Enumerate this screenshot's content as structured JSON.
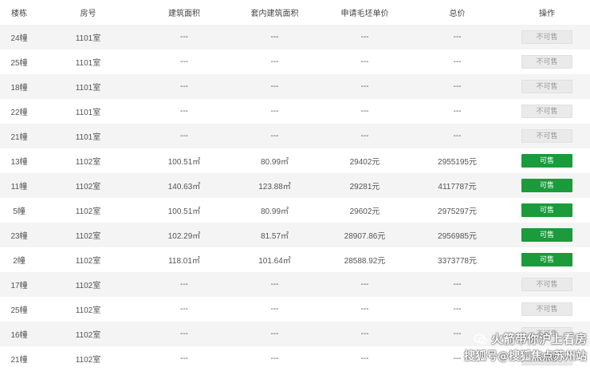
{
  "table": {
    "headers": [
      "楼栋",
      "房号",
      "建筑面积",
      "套内建筑面积",
      "申请毛坯单价",
      "总价",
      "操作"
    ],
    "rows": [
      {
        "building": "24幢",
        "room": "1101室",
        "area": "---",
        "inner_area": "---",
        "unit_price": "---",
        "total": "---",
        "status": "不可售",
        "available": false
      },
      {
        "building": "25幢",
        "room": "1101室",
        "area": "---",
        "inner_area": "---",
        "unit_price": "---",
        "total": "---",
        "status": "不可售",
        "available": false
      },
      {
        "building": "18幢",
        "room": "1101室",
        "area": "---",
        "inner_area": "---",
        "unit_price": "---",
        "total": "---",
        "status": "不可售",
        "available": false
      },
      {
        "building": "22幢",
        "room": "1101室",
        "area": "---",
        "inner_area": "---",
        "unit_price": "---",
        "total": "---",
        "status": "不可售",
        "available": false
      },
      {
        "building": "21幢",
        "room": "1101室",
        "area": "---",
        "inner_area": "---",
        "unit_price": "---",
        "total": "---",
        "status": "不可售",
        "available": false
      },
      {
        "building": "13幢",
        "room": "1102室",
        "area": "100.51㎡",
        "inner_area": "80.99㎡",
        "unit_price": "29402元",
        "total": "2955195元",
        "status": "可售",
        "available": true
      },
      {
        "building": "11幢",
        "room": "1102室",
        "area": "140.63㎡",
        "inner_area": "123.88㎡",
        "unit_price": "29281元",
        "total": "4117787元",
        "status": "可售",
        "available": true
      },
      {
        "building": "5幢",
        "room": "1102室",
        "area": "100.51㎡",
        "inner_area": "80.99㎡",
        "unit_price": "29602元",
        "total": "2975297元",
        "status": "可售",
        "available": true
      },
      {
        "building": "23幢",
        "room": "1102室",
        "area": "102.29㎡",
        "inner_area": "81.57㎡",
        "unit_price": "28907.86元",
        "total": "2956985元",
        "status": "可售",
        "available": true
      },
      {
        "building": "2幢",
        "room": "1102室",
        "area": "118.01㎡",
        "inner_area": "101.64㎡",
        "unit_price": "28588.92元",
        "total": "3373778元",
        "status": "可售",
        "available": true
      },
      {
        "building": "17幢",
        "room": "1102室",
        "area": "---",
        "inner_area": "---",
        "unit_price": "---",
        "total": "---",
        "status": "不可售",
        "available": false
      },
      {
        "building": "25幢",
        "room": "1102室",
        "area": "---",
        "inner_area": "---",
        "unit_price": "---",
        "total": "---",
        "status": "不可售",
        "available": false
      },
      {
        "building": "16幢",
        "room": "1102室",
        "area": "---",
        "inner_area": "---",
        "unit_price": "---",
        "total": "---",
        "status": "不可售",
        "available": false
      },
      {
        "building": "21幢",
        "room": "1102室",
        "area": "---",
        "inner_area": "---",
        "unit_price": "---",
        "total": "---",
        "status": "不可售",
        "available": false
      }
    ]
  },
  "watermark": {
    "line1": "火箭带你沪上看房",
    "line2": "搜狐号@搜狐焦点苏州站",
    "icon": "wechat-icon"
  },
  "colors": {
    "available_button": "#1b9b3b",
    "unavailable_button": "#eaeaea",
    "row_stripe": "#f4f4f4"
  }
}
